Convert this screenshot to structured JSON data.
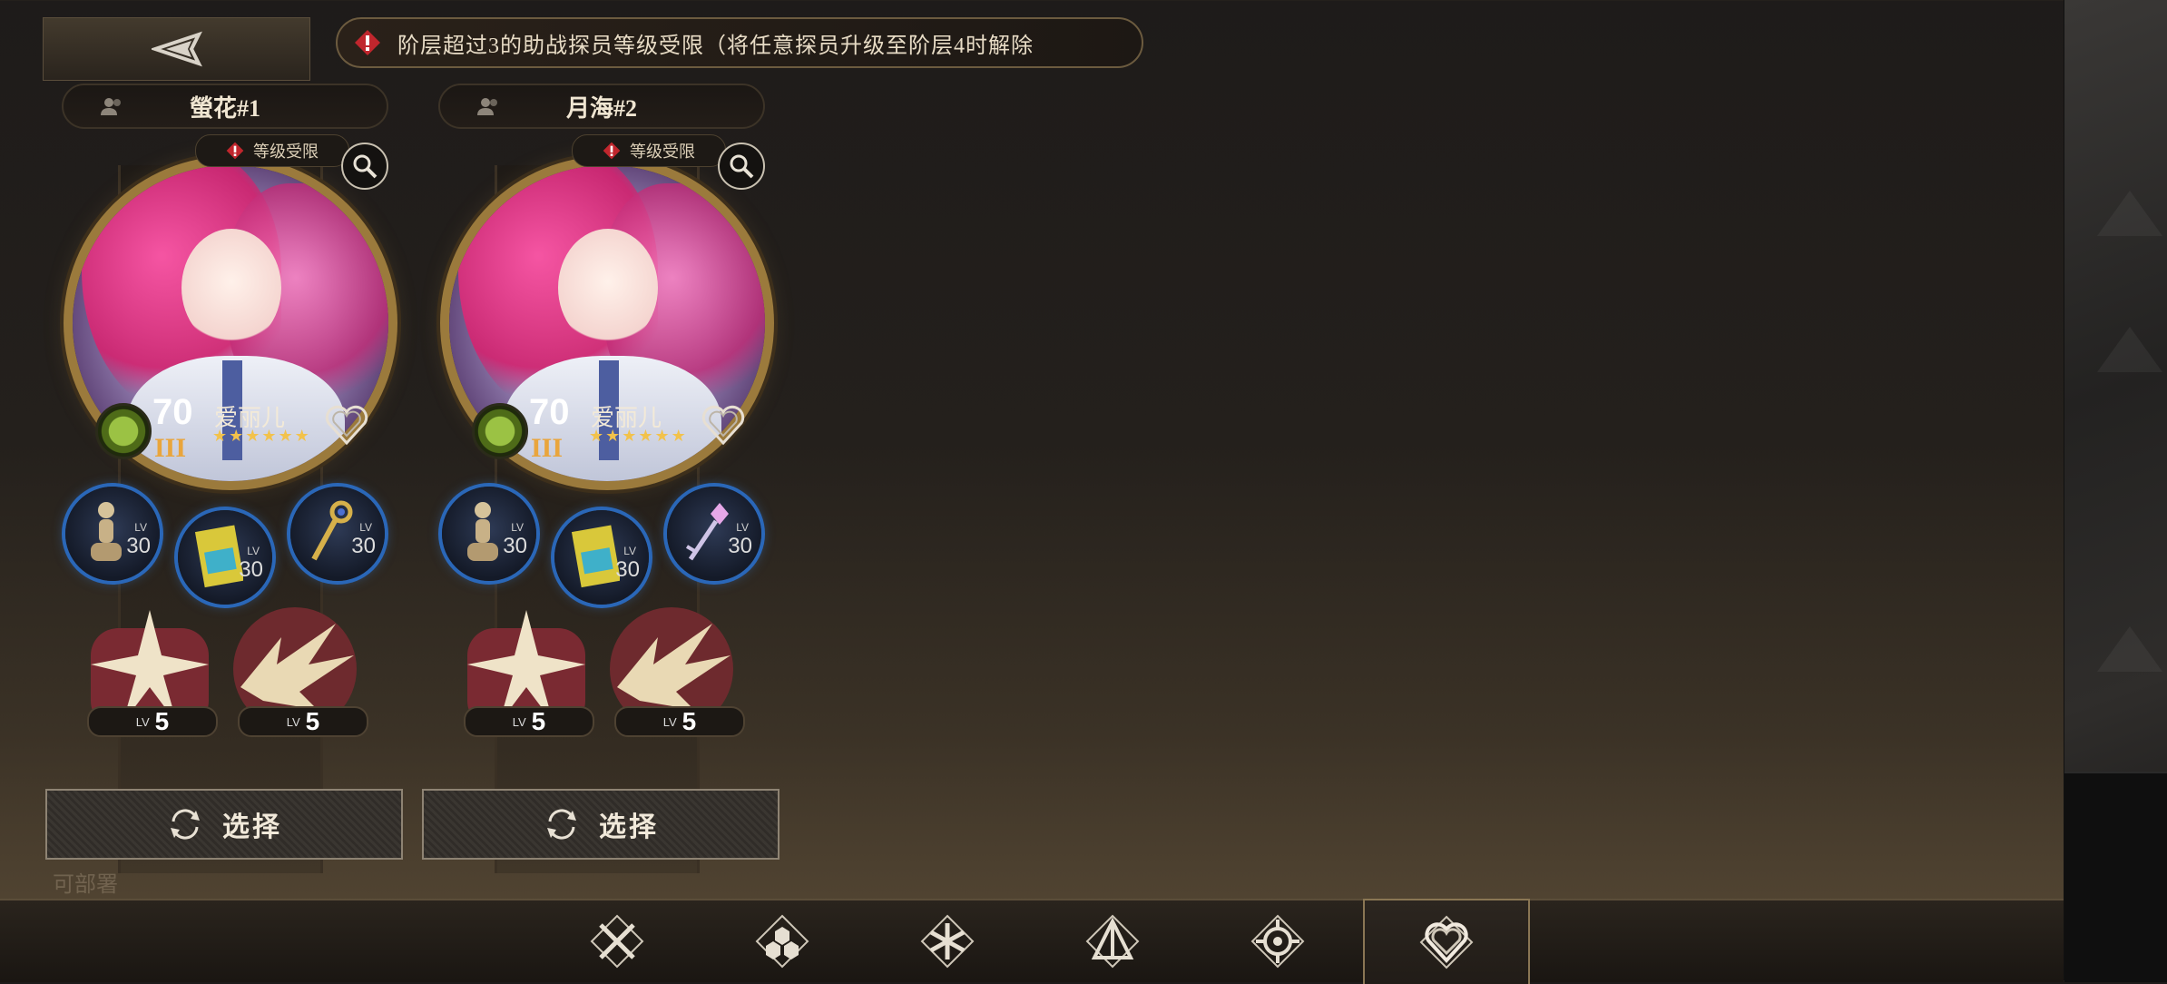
{
  "warning": {
    "text": "阶层超过3的助战探员等级受限（将任意探员升级至阶层4时解除"
  },
  "cards": [
    {
      "owner": "螢花#1",
      "lock_label": "等级受限",
      "level": "70",
      "rank": "III",
      "character": "爱丽儿",
      "stars": "★★★★★★",
      "equipment": [
        {
          "icon": "mannequin-icon",
          "lv_label": "LV",
          "lv": "30"
        },
        {
          "icon": "holiday-book-icon",
          "lv_label": "LV",
          "lv": "30"
        },
        {
          "icon": "golden-key-icon",
          "lv_label": "LV",
          "lv": "30"
        }
      ],
      "skills": [
        {
          "icon": "star-burst-skill-icon",
          "lv_label": "LV",
          "lv": "5"
        },
        {
          "icon": "dragon-skill-icon",
          "lv_label": "LV",
          "lv": "5"
        }
      ],
      "select_label": "选择"
    },
    {
      "owner": "月海#2",
      "lock_label": "等级受限",
      "level": "70",
      "rank": "III",
      "character": "爱丽儿",
      "stars": "★★★★★★",
      "equipment": [
        {
          "icon": "mannequin-icon",
          "lv_label": "LV",
          "lv": "30"
        },
        {
          "icon": "holiday-book-icon",
          "lv_label": "LV",
          "lv": "30"
        },
        {
          "icon": "crystal-key-icon",
          "lv_label": "LV",
          "lv": "30"
        }
      ],
      "skills": [
        {
          "icon": "star-burst-skill-icon",
          "lv_label": "LV",
          "lv": "5"
        },
        {
          "icon": "dragon-skill-icon",
          "lv_label": "LV",
          "lv": "5"
        }
      ],
      "select_label": "选择"
    }
  ],
  "deploy_hint": "可部署",
  "tabs": [
    {
      "icon": "crossed-swords-icon",
      "active": false
    },
    {
      "icon": "hexagon-cluster-icon",
      "active": false
    },
    {
      "icon": "snowflake-icon",
      "active": false
    },
    {
      "icon": "pyramid-icon",
      "active": false
    },
    {
      "icon": "crosshair-icon",
      "active": false
    },
    {
      "icon": "heart-icon",
      "active": true
    }
  ],
  "colors": {
    "accent_gold": "#9b7a3c",
    "warning_red": "#c0262d",
    "equip_ring_blue": "#2a67b8"
  }
}
